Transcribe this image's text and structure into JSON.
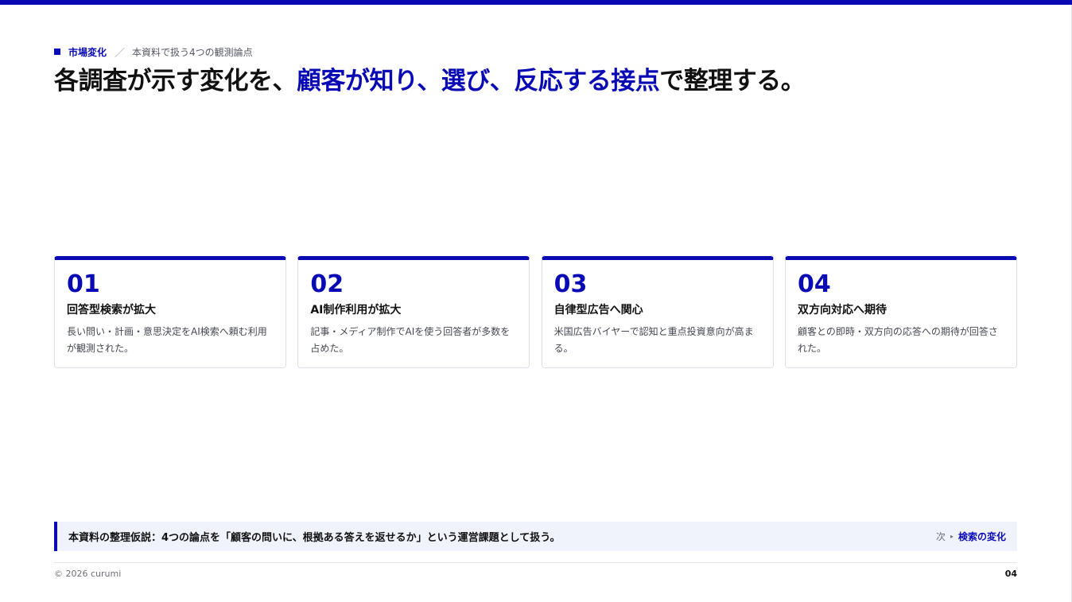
{
  "header": {
    "section": "市場変化",
    "separator": "／",
    "subtitle": "本資料で扱う4つの観測論点"
  },
  "headline": {
    "before": "各調査が示す変化を、",
    "accent": "顧客が知り、選び、反応する接点",
    "after": "で整理する。"
  },
  "cards": [
    {
      "number": "01",
      "title": "回答型検索が拡大",
      "description": "長い問い・計画・意思決定をAI検索へ頼む利用が観測された。"
    },
    {
      "number": "02",
      "title": "AI制作利用が拡大",
      "description": "記事・メディア制作でAIを使う回答者が多数を占めた。"
    },
    {
      "number": "03",
      "title": "自律型広告へ関心",
      "description": "米国広告バイヤーで認知と重点投資意向が高まる。"
    },
    {
      "number": "04",
      "title": "双方向対応へ期待",
      "description": "顧客との即時・双方向の応答への期待が回答された。"
    }
  ],
  "hypothesis": {
    "statement": "本資料の整理仮説：4つの論点を「顧客の問いに、根拠ある答えを返せるか」という運営課題として扱う。",
    "next_label": "次",
    "next_arrow": "▸",
    "next_topic": "検索の変化"
  },
  "footer": {
    "copyright": "© 2026 curumi",
    "page_number": "04"
  },
  "colors": {
    "accent": "#0a0ab4",
    "text": "#111111",
    "muted": "#6d707a",
    "hypothesis_bg": "#f0f3fc"
  }
}
